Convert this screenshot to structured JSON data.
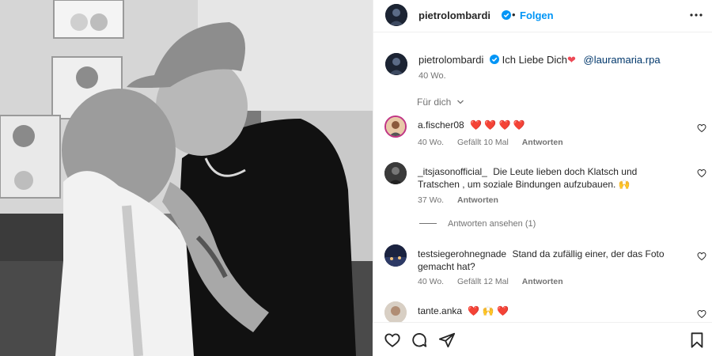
{
  "header": {
    "username": "pietrolombardi",
    "separator": "•",
    "follow_label": "Folgen"
  },
  "caption": {
    "username": "pietrolombardi",
    "text": "Ich Liebe Dich",
    "mention": "@lauramaria.rpa",
    "age": "40 Wo."
  },
  "for_you_label": "Für dich",
  "comments": [
    {
      "username": "a.fischer08",
      "text": "❤️ ❤️ ❤️ ❤️",
      "age": "40 Wo.",
      "likes": "Gefällt 10 Mal",
      "reply_label": "Antworten"
    },
    {
      "username": "_itsjasonofficial_",
      "text": "Die Leute lieben doch Klatsch und Tratschen , um soziale Bindungen aufzubauen. 🙌",
      "age": "37 Wo.",
      "reply_label": "Antworten",
      "view_replies": "Antworten ansehen (1)"
    },
    {
      "username": "testsiegerohnegnade",
      "text": "Stand da zufällig einer, der das Foto gemacht hat?",
      "age": "40 Wo.",
      "likes": "Gefällt 12 Mal",
      "reply_label": "Antworten"
    },
    {
      "username": "tante.anka",
      "text": "❤️ 🙌 ❤️"
    }
  ],
  "icons": {
    "verified": "verified-badge-icon",
    "more": "more-options-icon",
    "like": "heart-icon",
    "comment": "comment-icon",
    "share": "share-icon",
    "save": "bookmark-icon",
    "chevron": "chevron-down-icon"
  },
  "colors": {
    "accent": "#0095f6",
    "verified": "#0095f6",
    "heart": "#ed4956",
    "meta": "#737373",
    "mention": "#00376b"
  }
}
